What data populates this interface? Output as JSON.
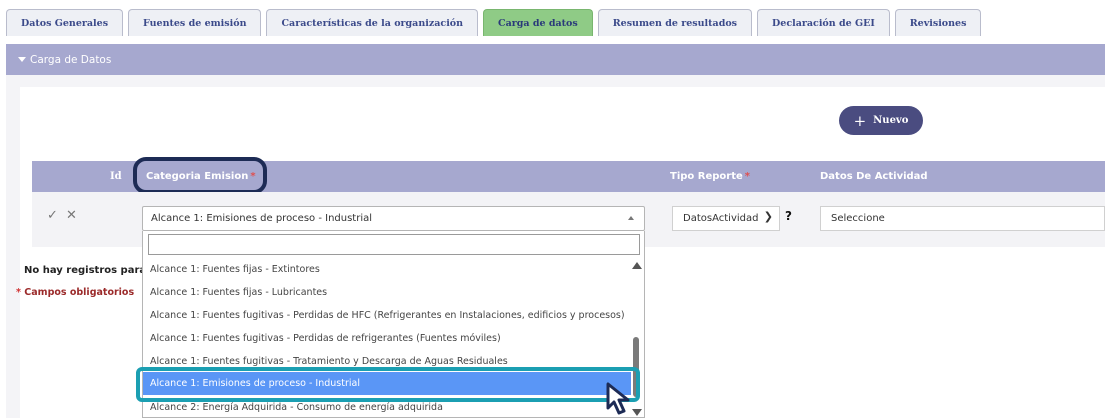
{
  "tabs": [
    {
      "label": "Datos Generales",
      "active": false
    },
    {
      "label": "Fuentes de emisión",
      "active": false
    },
    {
      "label": "Características de la organización",
      "active": false
    },
    {
      "label": "Carga de datos",
      "active": true
    },
    {
      "label": "Resumen de resultados",
      "active": false
    },
    {
      "label": "Declaración de GEI",
      "active": false
    },
    {
      "label": "Revisiones",
      "active": false
    }
  ],
  "section": {
    "title": "Carga de Datos"
  },
  "toolbar": {
    "nuevo_label": "Nuevo",
    "nuevo_icon": "+"
  },
  "grid": {
    "headers": {
      "id": "Id",
      "categoria": "Categoria Emision",
      "tipo": "Tipo Reporte",
      "datos": "Datos De Actividad",
      "required_mark": "*"
    },
    "edit_row": {
      "save_icon": "✓",
      "cancel_icon": "✕",
      "categoria_value": "Alcance 1: Emisiones de proceso - Industrial",
      "tipo_value": "DatosActividad",
      "help": "?",
      "datos_value": "Seleccione"
    },
    "empty_message": "No hay registros para mostrar",
    "required_note": "Campos obligatorios",
    "required_star": "*"
  },
  "dropdown": {
    "search_value": "",
    "options": [
      "Alcance 1: Fuentes fijas - Extintores",
      "Alcance 1: Fuentes fijas - Lubricantes",
      "Alcance 1: Fuentes fugitivas - Perdidas de HFC (Refrigerantes en Instalaciones, edificios y procesos)",
      "Alcance 1: Fuentes fugitivas - Perdidas de refrigerantes (Fuentes móviles)",
      "Alcance 1: Fuentes fugitivas - Tratamiento y Descarga de Aguas Residuales",
      "Alcance 1: Emisiones de proceso - Industrial",
      "Alcance 2: Energía Adquirida - Consumo de energía adquirida"
    ],
    "selected_index": 5
  },
  "colors": {
    "bar": "#a6a8cf",
    "active_tab": "#8fcb86",
    "nuevo_button": "#4a4c80",
    "selected_option": "#5a96f6",
    "highlight_dark": "#1d2b55",
    "highlight_teal": "#1b9fb2"
  }
}
